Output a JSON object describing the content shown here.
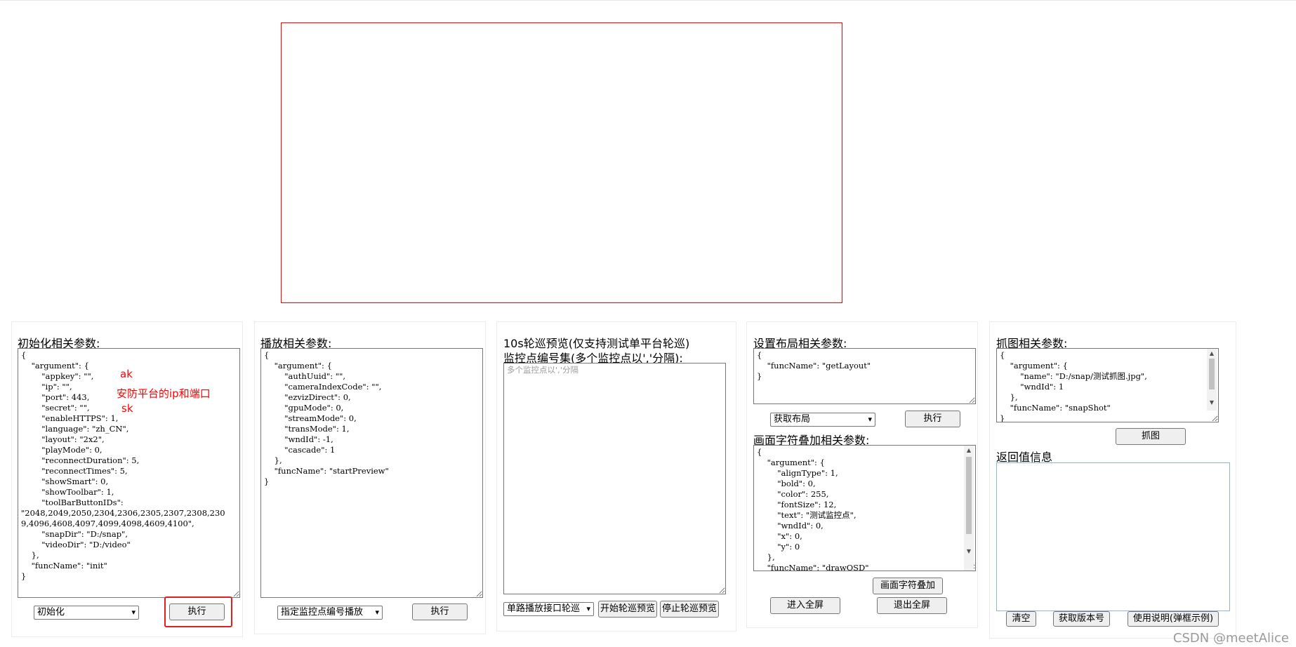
{
  "init": {
    "title": "初始化相关参数:",
    "json": "{\n    \"argument\": {\n        \"appkey\": \"\",\n        \"ip\": \"\",\n        \"port\": 443,\n        \"secret\": \"\",\n        \"enableHTTPS\": 1,\n        \"language\": \"zh_CN\",\n        \"layout\": \"2x2\",\n        \"playMode\": 0,\n        \"reconnectDuration\": 5,\n        \"reconnectTimes\": 5,\n        \"showSmart\": 0,\n        \"showToolbar\": 1,\n        \"toolBarButtonIDs\":\n\"2048,2049,2050,2304,2306,2305,2307,2308,230\n9,4096,4608,4097,4099,4098,4609,4100\",\n        \"snapDir\": \"D:/snap\",\n        \"videoDir\": \"D:/video\"\n    },\n    \"funcName\": \"init\"\n}",
    "select": "初始化",
    "execute": "执行",
    "annotations": {
      "ak": "ak",
      "ip_port": "安防平台的ip和端口",
      "sk": "sk"
    }
  },
  "play": {
    "title": "播放相关参数:",
    "json": "{\n    \"argument\": {\n        \"authUuid\": \"\",\n        \"cameraIndexCode\": \"\",\n        \"ezvizDirect\": 0,\n        \"gpuMode\": 0,\n        \"streamMode\": 0,\n        \"transMode\": 1,\n        \"wndId\": -1,\n        \"cascade\": 1\n    },\n    \"funcName\": \"startPreview\"\n}",
    "select": "指定监控点编号播放",
    "execute": "执行"
  },
  "patrol": {
    "title": "10s轮巡预览(仅支持测试单平台轮巡)",
    "subtitle": "监控点编号集(多个监控点以','分隔):",
    "placeholder": "多个监控点以','分隔",
    "select": "单路播放接口轮巡",
    "start": "开始轮巡预览",
    "stop": "停止轮巡预览"
  },
  "layout": {
    "title": "设置布局相关参数:",
    "json": "{\n    \"funcName\": \"getLayout\"\n}",
    "select": "获取布局",
    "execute": "执行",
    "osd_title": "画面字符叠加相关参数:",
    "osd_json": "{\n    \"argument\": {\n        \"alignType\": 1,\n        \"bold\": 0,\n        \"color\": 255,\n        \"fontSize\": 12,\n        \"text\": \"测试监控点\",\n        \"wndId\": 0,\n        \"x\": 0,\n        \"y\": 0\n    },\n    \"funcName\": \"drawOSD\"\n}",
    "osd_button": "画面字符叠加",
    "fullscreen": "进入全屏",
    "exit_fullscreen": "退出全屏"
  },
  "snap": {
    "title": "抓图相关参数:",
    "json": "{\n    \"argument\": {\n        \"name\": \"D:/snap/测试抓图.jpg\",\n        \"wndId\": 1\n    },\n    \"funcName\": \"snapShot\"\n}",
    "button": "抓图",
    "return_title": "返回值信息",
    "clear": "清空",
    "version": "获取版本号",
    "help": "使用说明(弹框示例)"
  },
  "watermark": "CSDN @meetAlice",
  "colors": {
    "video_border": "#ff0000",
    "annotation": "#ff0000",
    "highlight": "#e02020"
  },
  "icons": {
    "select_chevron": "chevron-down-icon"
  }
}
